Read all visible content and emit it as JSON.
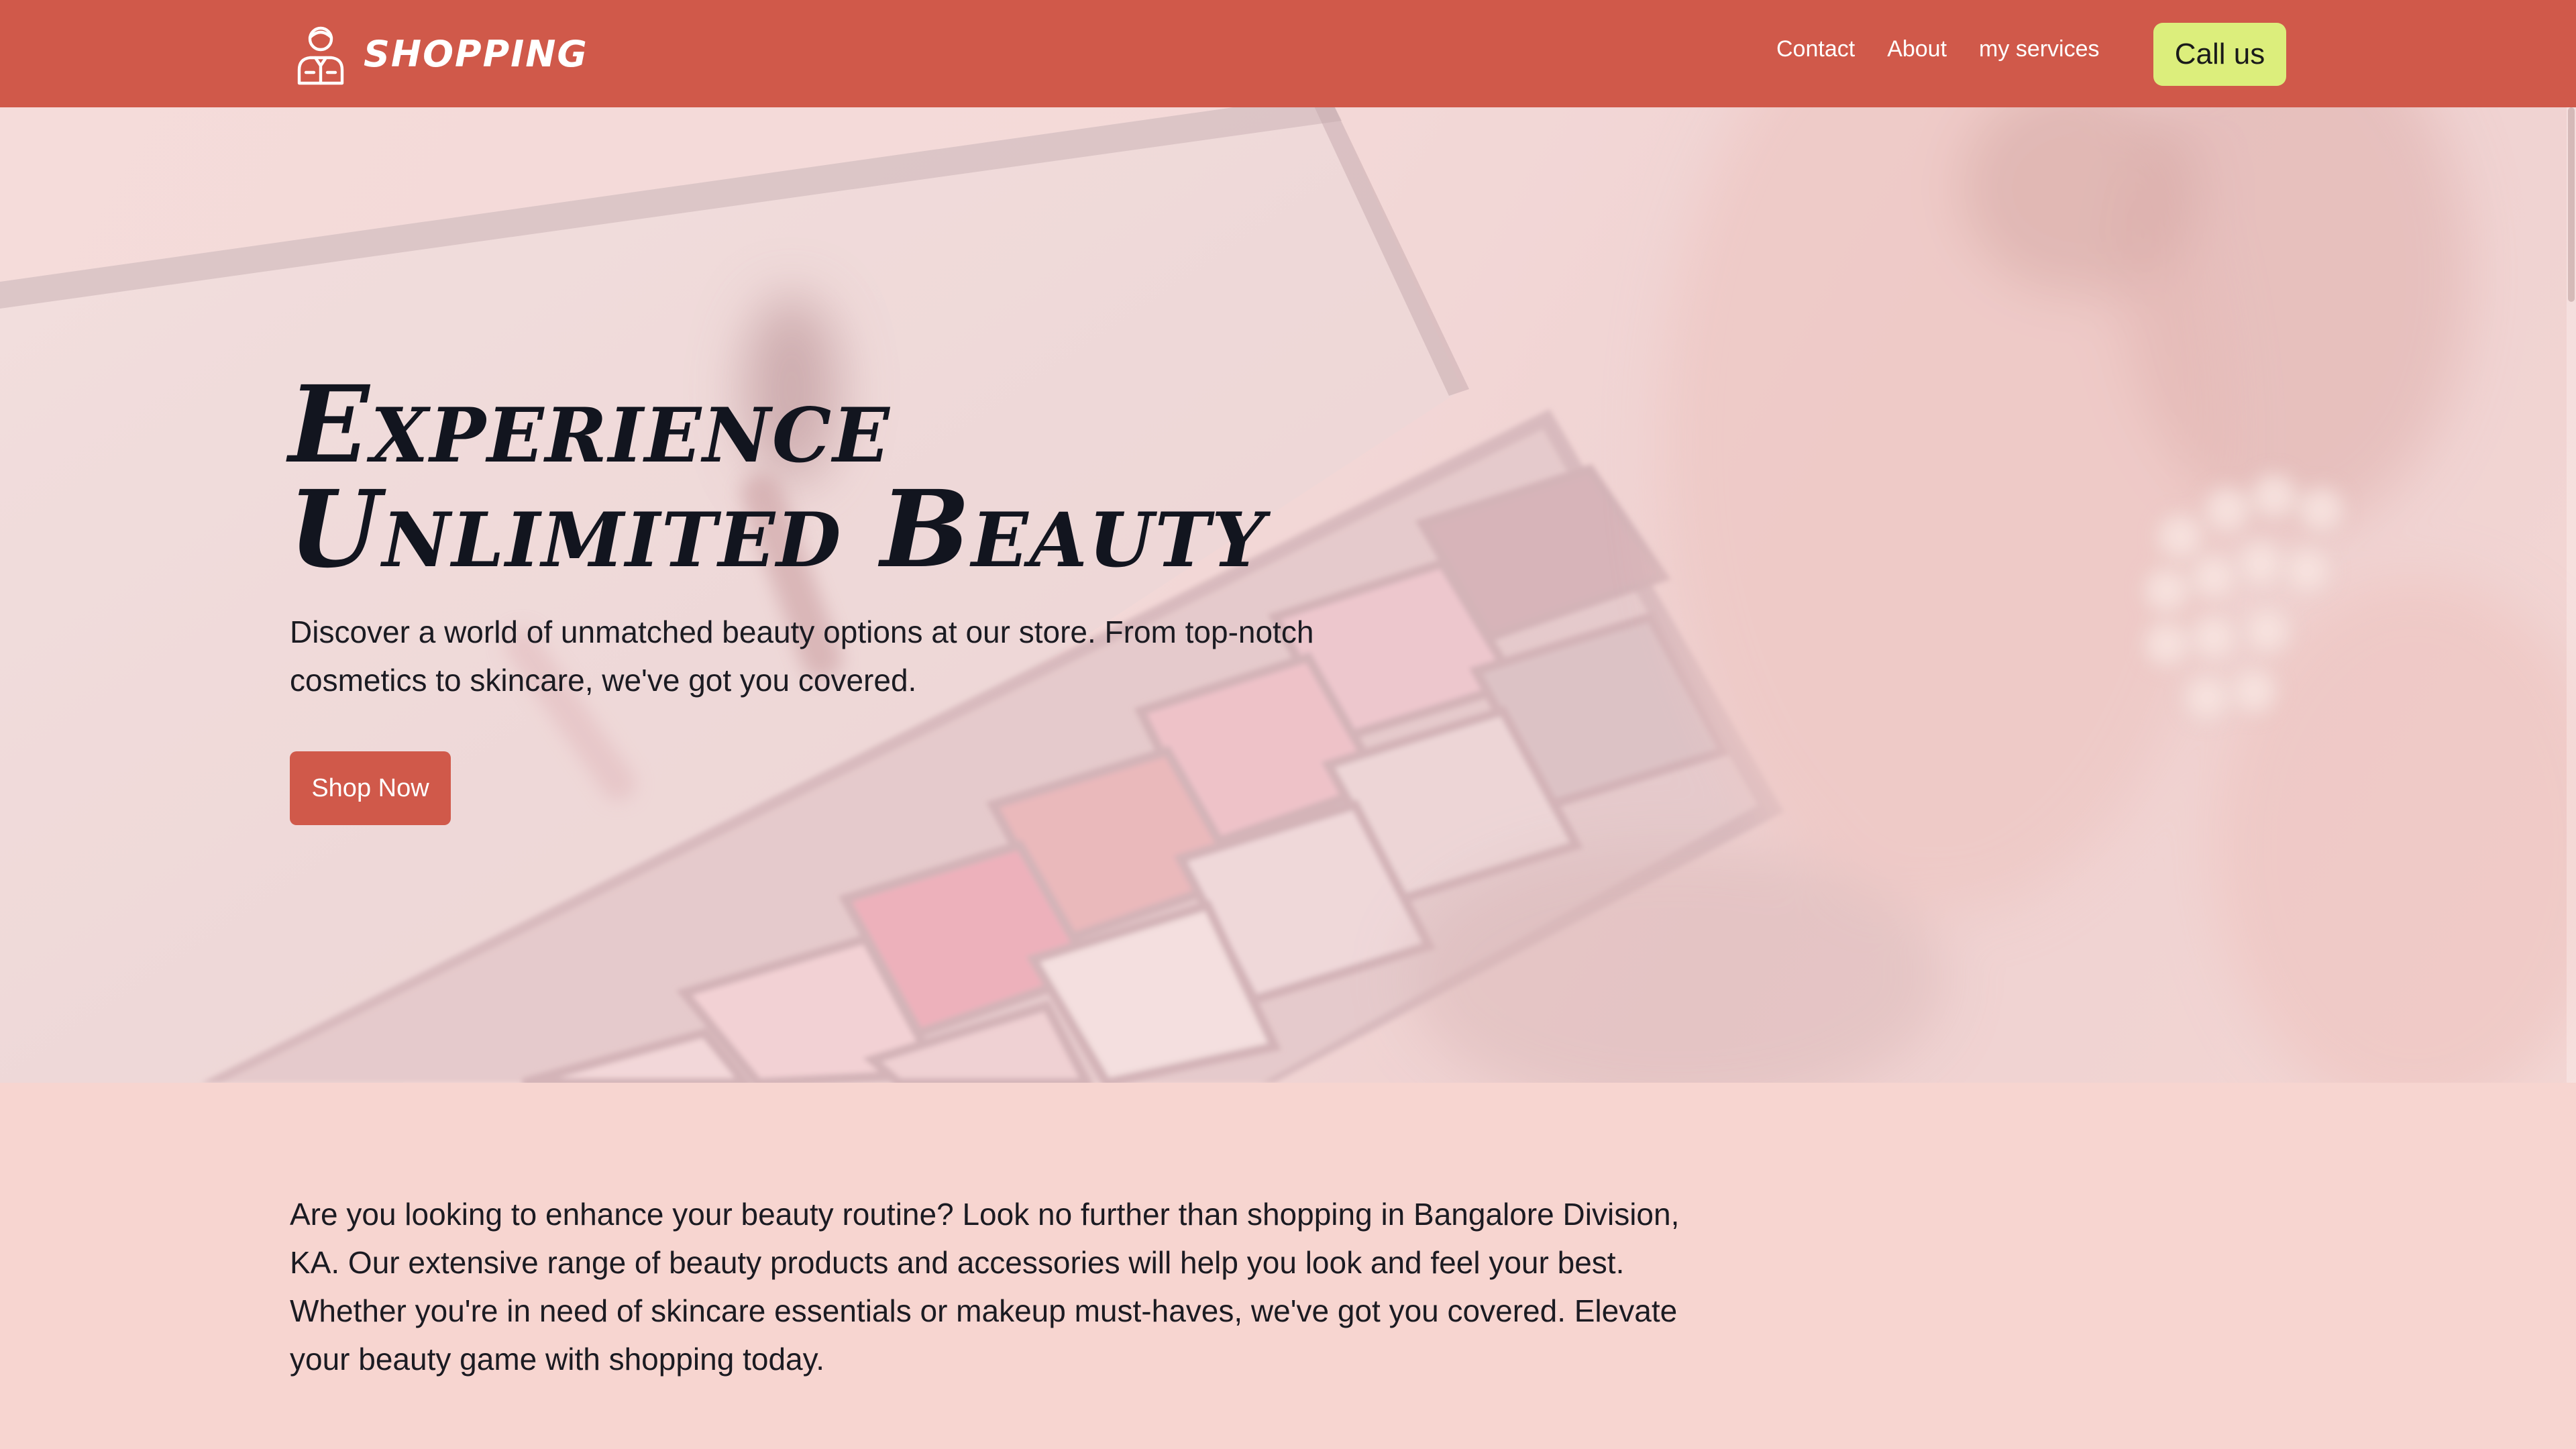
{
  "header": {
    "brand_name": "shopping",
    "nav": [
      {
        "label": "Contact"
      },
      {
        "label": "About"
      },
      {
        "label": "my services"
      }
    ],
    "cta_label": "Call us"
  },
  "hero": {
    "title": "Experience Unlimited Beauty",
    "subtitle": "Discover a world of unmatched beauty options at our store. From top-notch cosmetics to skincare, we've got you covered.",
    "button_label": "Shop Now",
    "background_image": "eyeshadow-palette-photo"
  },
  "intro": {
    "text": "Are you looking to enhance your beauty routine? Look no further than shopping in Bangalore Division, KA. Our extensive range of beauty products and accessories will help you look and feel your best. Whether you're in need of skincare essentials or makeup must-haves, we've got you covered. Elevate your beauty game with shopping today."
  },
  "colors": {
    "header_bg": "#d0594a",
    "cta_bg": "#dcee7c",
    "page_bg": "#f7d5d0",
    "button_bg": "#d0594a",
    "text_dark": "#12151f"
  },
  "icons": {
    "brand": "person-avatar-icon"
  }
}
